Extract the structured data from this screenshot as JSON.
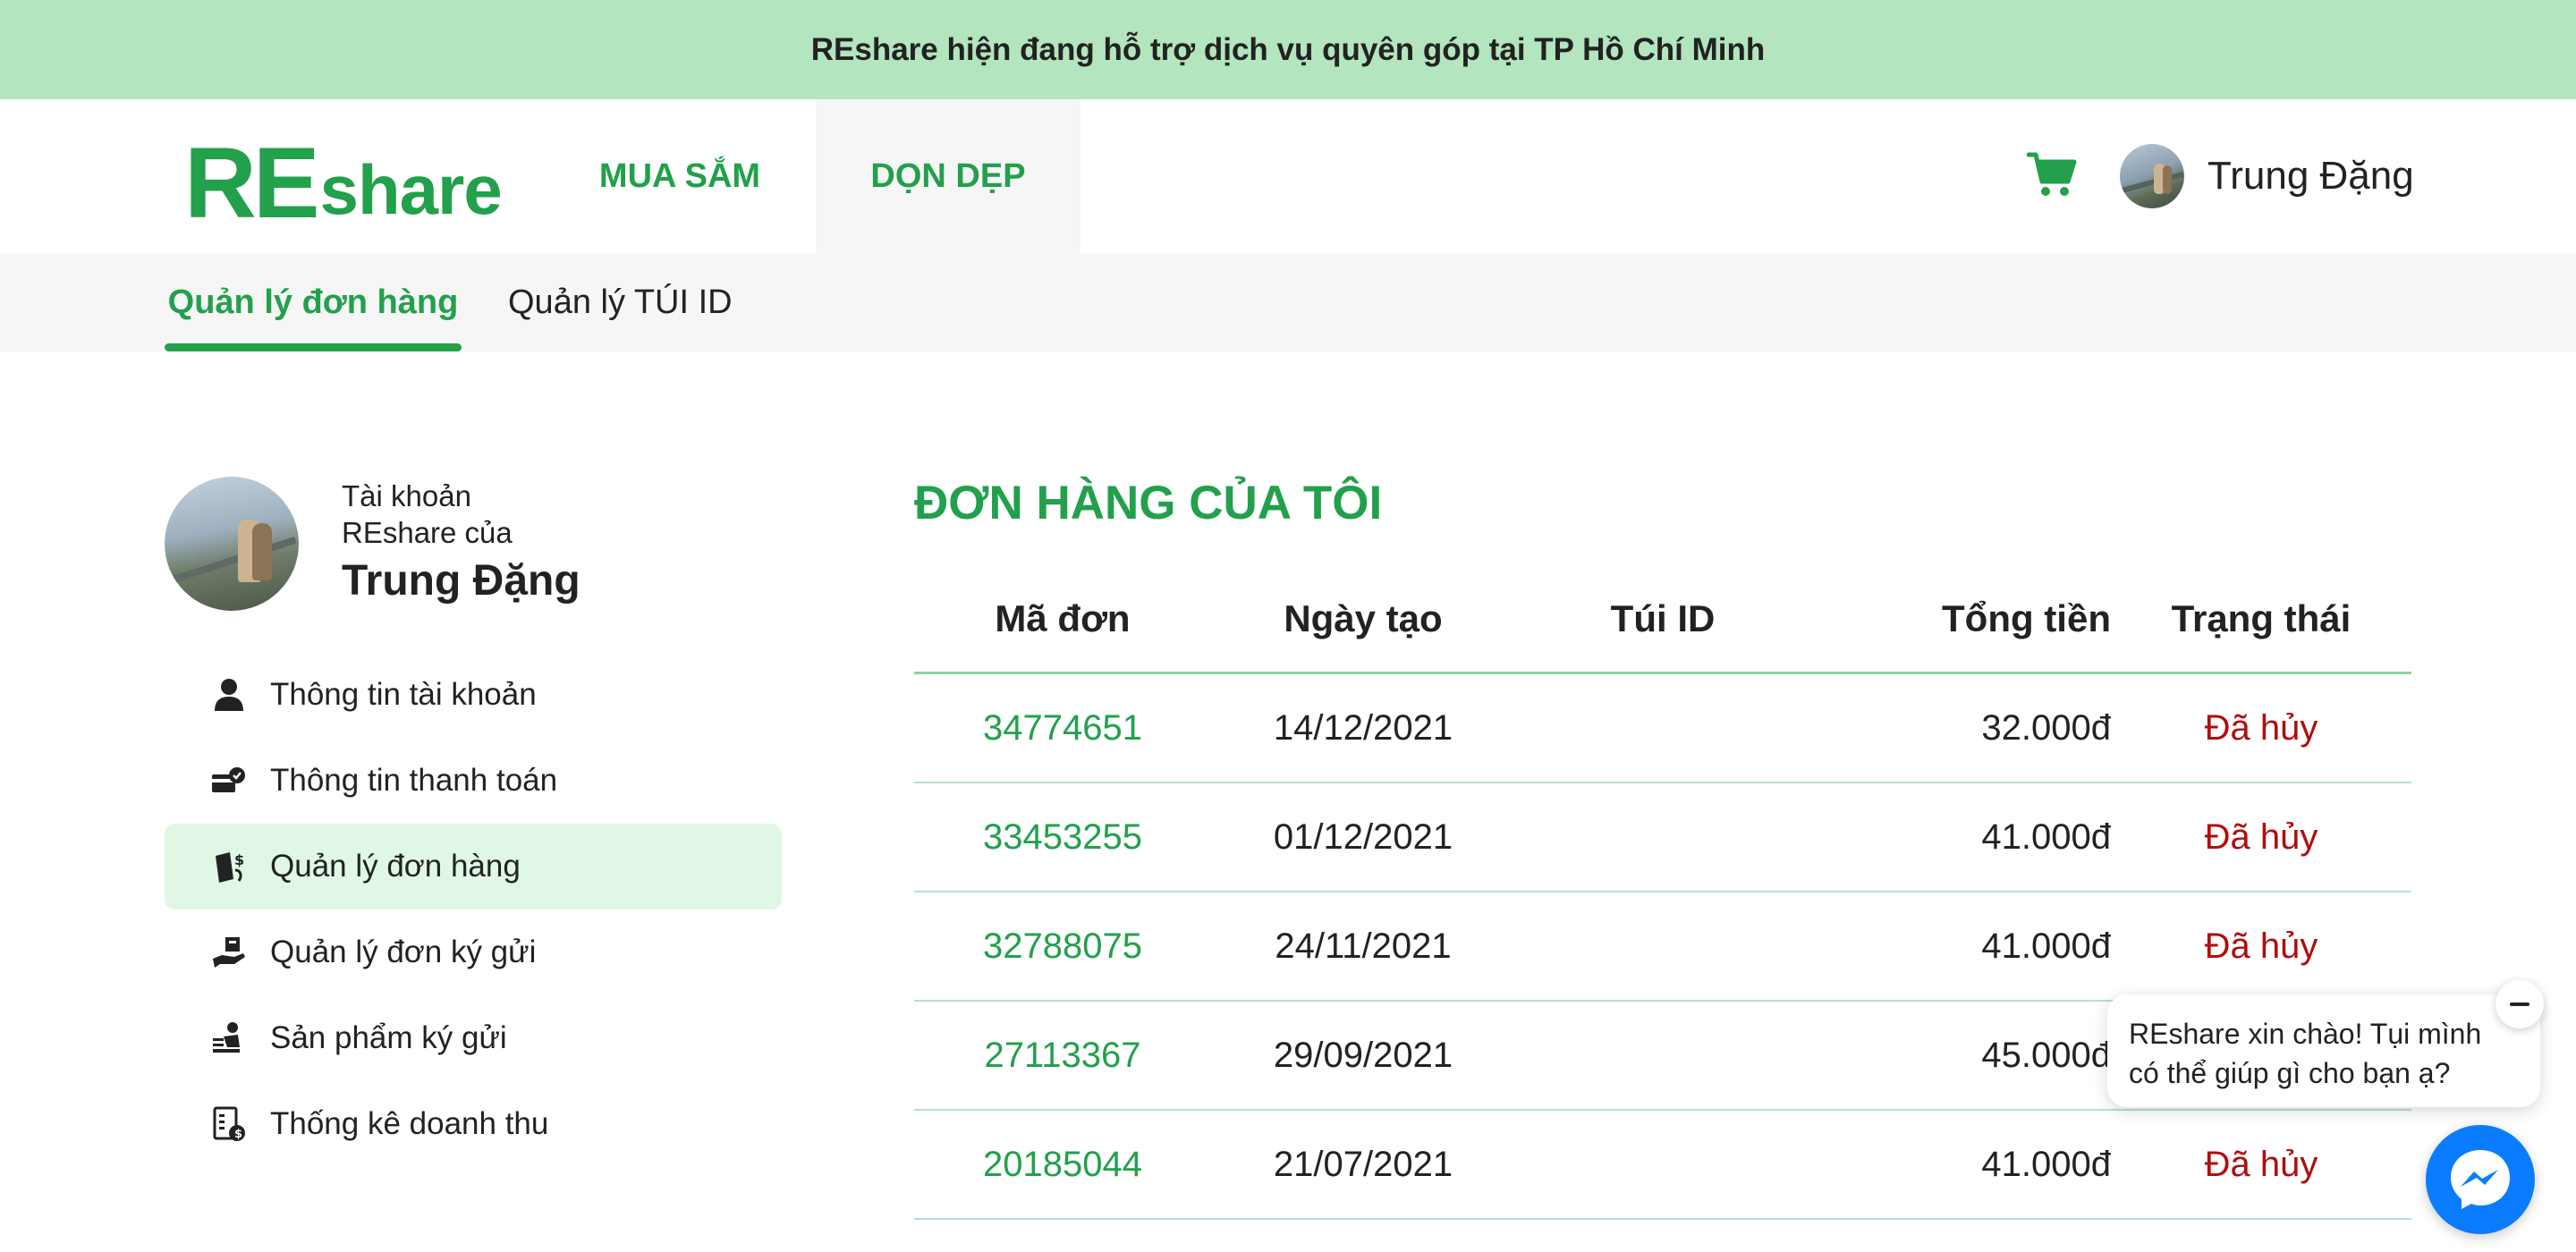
{
  "banner": {
    "text": "REshare hiện đang hỗ trợ dịch vụ quyên góp tại TP Hồ Chí Minh"
  },
  "header": {
    "logo_re": "RE",
    "logo_share": "share",
    "nav": [
      {
        "label": "MUA SẮM"
      },
      {
        "label": "DỌN DẸP"
      }
    ],
    "cart_icon": "shopping-cart-icon",
    "user_name": "Trung Đặng"
  },
  "subnav": {
    "tabs": [
      {
        "label": "Quản lý đơn hàng",
        "active": true
      },
      {
        "label": "Quản lý TÚI ID",
        "active": false
      }
    ]
  },
  "profile": {
    "line1": "Tài khoản",
    "line2": "REshare của",
    "name": "Trung Đặng"
  },
  "sidebar": {
    "items": [
      {
        "label": "Thông tin tài khoản",
        "icon": "user-icon",
        "active": false
      },
      {
        "label": "Thông tin thanh toán",
        "icon": "payment-card-icon",
        "active": false
      },
      {
        "label": "Quản lý đơn hàng",
        "icon": "order-money-icon",
        "active": true
      },
      {
        "label": "Quản lý đơn ký gửi",
        "icon": "consignment-hand-icon",
        "active": false
      },
      {
        "label": "Sản phẩm ký gửi",
        "icon": "consigned-product-icon",
        "active": false
      },
      {
        "label": "Thống kê doanh thu",
        "icon": "revenue-report-icon",
        "active": false
      }
    ]
  },
  "orders": {
    "title": "ĐƠN HÀNG CỦA TÔI",
    "columns": {
      "id": "Mã đơn",
      "date": "Ngày tạo",
      "bag": "Túi ID",
      "total": "Tổng tiền",
      "status": "Trạng thái"
    },
    "rows": [
      {
        "id": "34774651",
        "date": "14/12/2021",
        "bag": "",
        "total": "32.000đ",
        "status": "Đã hủy"
      },
      {
        "id": "33453255",
        "date": "01/12/2021",
        "bag": "",
        "total": "41.000đ",
        "status": "Đã hủy"
      },
      {
        "id": "32788075",
        "date": "24/11/2021",
        "bag": "",
        "total": "41.000đ",
        "status": "Đã hủy"
      },
      {
        "id": "27113367",
        "date": "29/09/2021",
        "bag": "",
        "total": "45.000đ",
        "status": ""
      },
      {
        "id": "20185044",
        "date": "21/07/2021",
        "bag": "",
        "total": "41.000đ",
        "status": "Đã hủy"
      }
    ]
  },
  "chat": {
    "line1": "REshare xin chào! Tụi mình",
    "line2": "có thể giúp gì cho bạn ạ?"
  },
  "colors": {
    "brand_green": "#22a04b",
    "banner_bg": "#b3e5bf",
    "cancelled_red": "#b00d0d",
    "messenger_blue": "#0a7cff"
  }
}
